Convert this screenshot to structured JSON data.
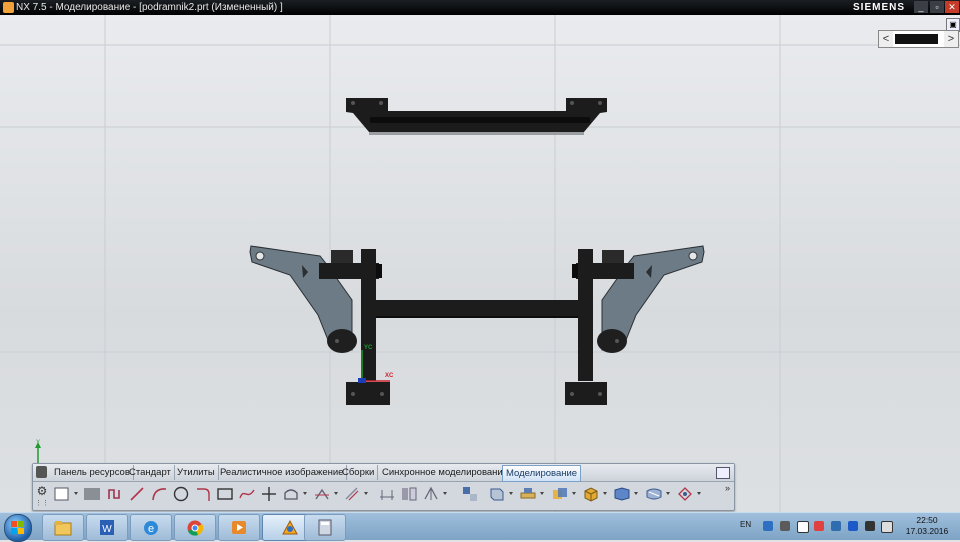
{
  "window": {
    "title": "NX 7.5 - Моделирование - [podramnik2.prt (Измененный) ]",
    "brand": "SIEMENS",
    "controls": {
      "minimize": "_",
      "restore": "▫",
      "close": "✕"
    }
  },
  "viewport": {
    "triad_top": {
      "xc": "XC",
      "yc": "YC"
    },
    "triad_corner": {
      "label": "Y"
    },
    "nav": {
      "left_arrow": "<",
      "right_arrow": ">"
    }
  },
  "ribbon": {
    "tabs": [
      {
        "label": "Панель ресурсов"
      },
      {
        "label": "Стандарт"
      },
      {
        "label": "Утилиты"
      },
      {
        "label": "Реалистичное изображение"
      },
      {
        "label": "Сборки"
      },
      {
        "label": "Синхронное моделирование"
      },
      {
        "label": "Моделирование"
      }
    ],
    "active_tab": "Моделирование",
    "gear": "⚙",
    "overflow": "»",
    "tools": [
      "sheet-icon",
      "fill-icon",
      "profile-icon",
      "line-icon",
      "arc-icon",
      "circle-icon",
      "fillet-icon",
      "rectangle-icon",
      "spline-icon",
      "point-icon",
      "extrude-shape-icon",
      "trim-icon",
      "offset-icon",
      "dimension-icon",
      "mirror-icon",
      "pattern-icon",
      "assembly-icon",
      "datum-plane-icon",
      "sheet-metal-icon",
      "unite-icon",
      "box-icon",
      "surface-icon",
      "measure-icon"
    ]
  },
  "taskbar": {
    "apps": [
      "explorer-icon",
      "word-icon",
      "ie-icon",
      "chrome-icon",
      "media-icon",
      "nx-icon",
      "calculator-icon"
    ],
    "active_app": "nx-icon",
    "language": "EN",
    "time": "22:50",
    "date": "17.03.2016"
  },
  "colors": {
    "titlebar": "#0d1014",
    "part_dark": "#1c1c1c",
    "part_blue": "#6d7b86",
    "ribbon_bg": "#d3d8df",
    "taskbar": "#8fb0d0"
  }
}
